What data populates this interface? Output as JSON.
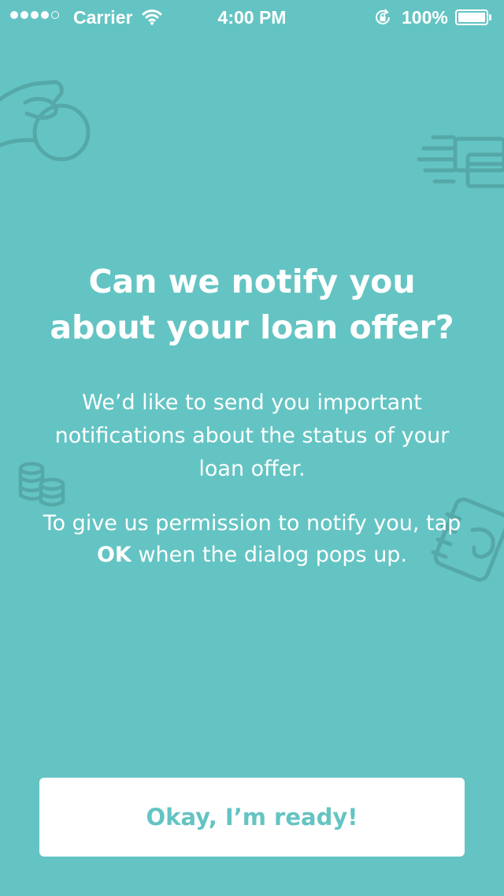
{
  "status_bar": {
    "carrier": "Carrier",
    "time": "4:00 PM",
    "battery": "100%",
    "signal_bars_filled": 4,
    "signal_bars_total": 5
  },
  "prompt": {
    "title": "Can we notify you about your loan offer?",
    "description": "We’d like to send you important notifications about the status of your loan offer.",
    "instruction_prefix": "To give us permission to notify you, tap ",
    "instruction_emphasis": "OK",
    "instruction_suffix": " when the dialog pops up."
  },
  "actions": {
    "confirm_label": "Okay, I’m ready!"
  },
  "theme": {
    "background": "#64c4c3",
    "decoration_stroke": "#55a8a8",
    "button_background": "#ffffff",
    "button_text": "#64c4c3"
  },
  "icons": {
    "wifi": "wifi-icon",
    "rotation_lock": "rotation-lock-icon",
    "battery": "battery-icon",
    "decorations": [
      "hand-coin-icon",
      "credit-cards-icon",
      "coin-stack-icon",
      "notebook-icon"
    ]
  }
}
